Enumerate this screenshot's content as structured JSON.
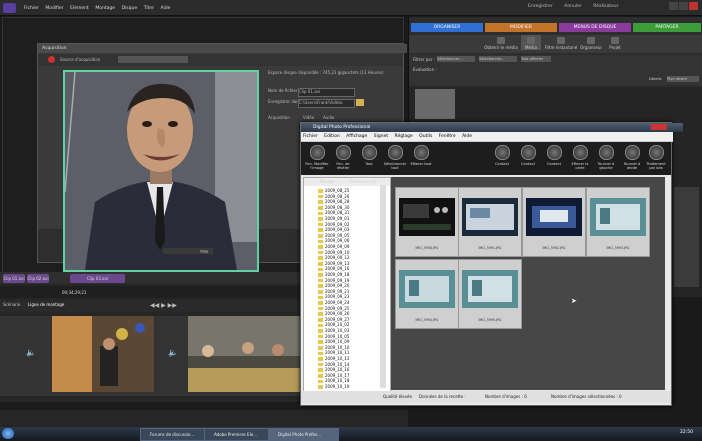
{
  "premiere": {
    "menu": [
      "Fichier",
      "Modifier",
      "Elément",
      "Montage",
      "Disque",
      "Titre",
      "Aide"
    ],
    "topright": [
      "Enregistrer",
      "Annuler",
      "Réalisateur"
    ],
    "acquisition": {
      "title": "Acquisition",
      "source_label": "Source d'acquisition",
      "free_space": "Espace disque disponible : 745,23 gigaoctets (13 Heures)",
      "filename_label": "Nom de fichier :",
      "filename_value": "Clip 01.avi",
      "save_label": "Enregistrer dans :",
      "save_value": "C:\\Users\\Frank\\Vidéos",
      "acq_title": "Acquisition",
      "video": "Vidéo",
      "audio": "Audio",
      "stop_btn": "Stop"
    },
    "timeline": {
      "tabs": [
        "Clip 01.avi",
        "Clip 02.avi",
        "Clip 03.avi"
      ],
      "timecode": "00;34;29;21",
      "track_tabs": [
        "Scénario",
        "Ligne de montage"
      ]
    }
  },
  "organizer": {
    "tabs": [
      {
        "label": "ORGANISER",
        "color": "#2f6fd6"
      },
      {
        "label": "MODIFIER",
        "color": "#c2742a"
      },
      {
        "label": "MENUS DE DISQUE",
        "color": "#8a3b9c"
      },
      {
        "label": "PARTAGER",
        "color": "#3c9c3a"
      }
    ],
    "tools": [
      "Obtenir le média",
      "Média",
      "Filtre instantané",
      "Organiseur",
      "Projet"
    ],
    "filter_label": "Filtrer par :",
    "filter_select": "Sélectionner...",
    "show_all": "Tout afficher",
    "rating_label": "Evaluation :",
    "details": "Détails",
    "plus_recent": "Plus récent"
  },
  "dpp": {
    "title": "Digital Photo Professional",
    "menu": [
      "Fichier",
      "Edition",
      "Affichage",
      "Signet",
      "Réglage",
      "Outils",
      "Fenêtre",
      "Aide"
    ],
    "tools_left": [
      "Fen. Modifier l'image",
      "Fen. de révéler",
      "Tout",
      "Sélectionner tout",
      "Effacer tout"
    ],
    "tools_right": [
      "Contact",
      "Contact",
      "Contact",
      "Effacer la carte",
      "Tourner à gauche",
      "Tourner à droite",
      "Traitement par lots"
    ],
    "tree_tabs": [
      "Dossier",
      "Collection (0)"
    ],
    "folders": [
      "2009_08_25",
      "2009_08_26",
      "2009_08_28",
      "2009_08_30",
      "2009_08_31",
      "2009_09_01",
      "2009_09_02",
      "2009_09_03",
      "2009_09_05",
      "2009_09_06",
      "2009_09_09",
      "2009_09_10",
      "2009_09_12",
      "2009_09_13",
      "2009_09_16",
      "2009_09_18",
      "2009_09_19",
      "2009_09_20",
      "2009_09_21",
      "2009_09_23",
      "2009_09_24",
      "2009_09_25",
      "2009_09_26",
      "2009_09_27",
      "2009_10_02",
      "2009_10_03",
      "2009_10_05",
      "2009_10_09",
      "2009_10_10",
      "2009_10_11",
      "2009_10_13",
      "2009_10_14",
      "2009_10_16",
      "2009_10_17",
      "2009_10_18",
      "2009_10_19"
    ],
    "thumbs": [
      "IMG_3990.JPG",
      "IMG_3991.JPG",
      "IMG_3992.JPG",
      "IMG_3993.JPG",
      "IMG_3994.JPG",
      "IMG_3995.JPG"
    ],
    "status": {
      "quality": "Qualité élevée",
      "recipe": "Données de la recette :",
      "count": "Nombre d'images : 6",
      "selected": "Nombre d'images sélectionnées : 0"
    }
  },
  "taskbar": {
    "items": [
      "Forums de discussio...",
      "Adobe Premiere Ele...",
      "Digital Photo Profes..."
    ],
    "time": "22:50"
  }
}
